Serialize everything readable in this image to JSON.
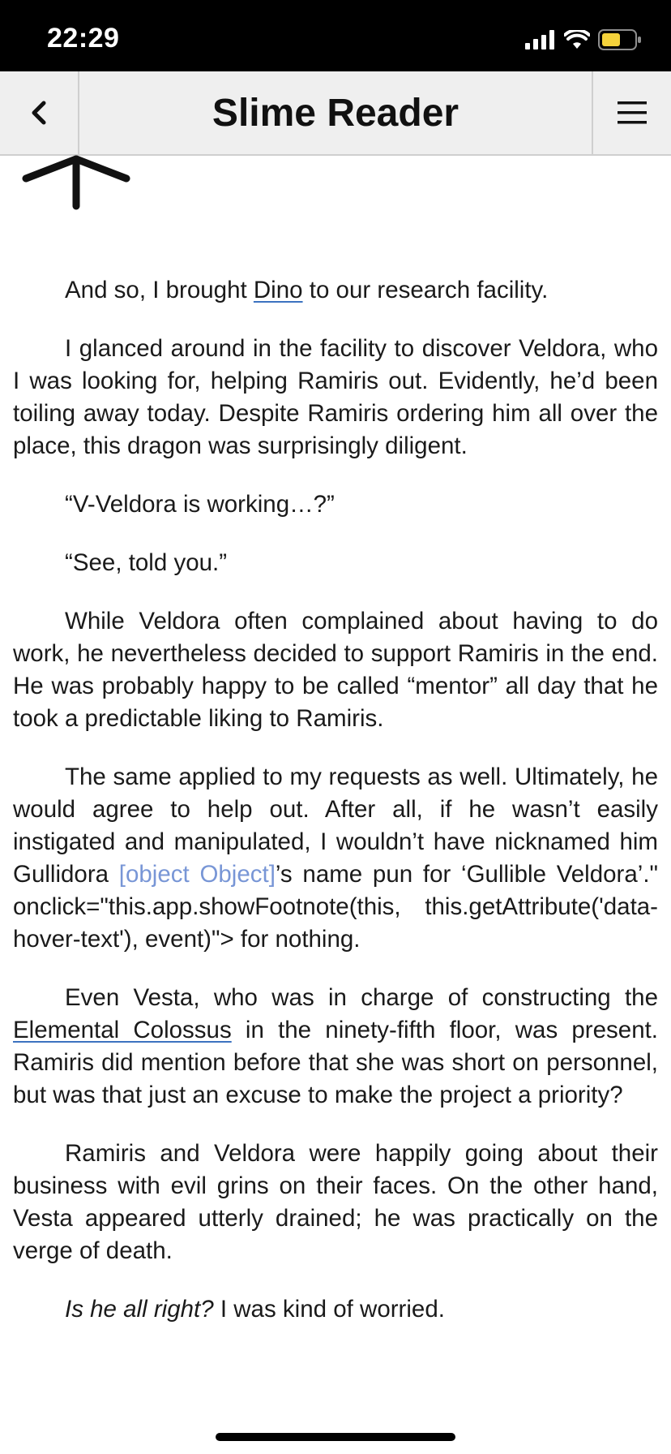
{
  "status_bar": {
    "time": "22:29",
    "battery_color": "#f5d33b"
  },
  "nav": {
    "title": "Slime Reader",
    "back_icon": "chevron-left-icon",
    "menu_icon": "hamburger-menu-icon"
  },
  "scroll_up_icon": "arrow-up-icon",
  "content": {
    "p1": {
      "before": "And so, I brought ",
      "link": "Dino",
      "after": " to our research facility."
    },
    "p2": "I glanced around in the facility to discover Veldora, who I was looking for, helping Ramiris out. Evidently, he’d been toiling away today. Despite Ramiris ordering him all over the place, this dragon was surprisingly diligent.",
    "p3": "“V-Veldora is working…?”",
    "p4": "“See, told you.”",
    "p5": "While Veldora often complained about having to do work, he nevertheless decided to support Ramiris in the end. He was probably happy to be called “mentor” all day that he took a predictable liking to Ramiris.",
    "p6": {
      "before": "The same applied to my requests as well. Ultimately, he would agree to help out. After all, if he wasn’t easily instigated and manipulated, I wouldn’t have nicknamed him Gullidora ",
      "footnote": "[object Object]",
      "after": "’s name pun for ‘Gullible Veldora’.\" onclick=\"this.app.showFootnote(this, this.getAttribute('data-hover-text'), event)\"> for nothing."
    },
    "p7": {
      "before": "Even Vesta, who was in charge of constructing the ",
      "link": "Elemental Colossus",
      "after": " in the ninety-fifth floor, was present. Ramiris did mention before that she was short on personnel, but was that just an excuse to make the project a priority?"
    },
    "p8": "Ramiris and Veldora were happily going about their business with evil grins on their faces. On the other hand, Vesta appeared utterly drained; he was practically on the verge of death.",
    "p9": {
      "italic": "Is he all right?",
      "after": " I was kind of worried."
    }
  },
  "colors": {
    "link_underline": "#3c72c0",
    "footnote": "#7896d6",
    "nav_background": "#efefef"
  }
}
